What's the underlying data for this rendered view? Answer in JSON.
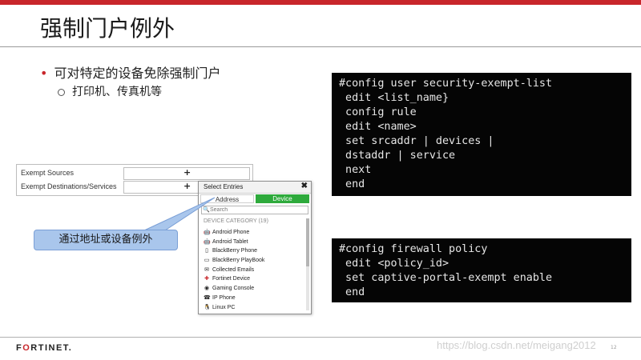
{
  "slide": {
    "title": "强制门户例外",
    "bullet_main": "可对特定的设备免除强制门户",
    "bullet_sub": "打印机、传真机等"
  },
  "exempt_form": {
    "rows": [
      {
        "label": "Exempt Sources",
        "add": "+"
      },
      {
        "label": "Exempt Destinations/Services",
        "add": "+"
      }
    ]
  },
  "select_popup": {
    "title": "Select Entries",
    "close": "✖",
    "tabs": [
      {
        "label": "Address",
        "active": false
      },
      {
        "label": "Device",
        "active": true
      }
    ],
    "search_placeholder": "Search",
    "category_label": "DEVICE CATEGORY (19)",
    "items": [
      {
        "label": "Android Phone",
        "icon": "android-icon",
        "color": "#7cb342"
      },
      {
        "label": "Android Tablet",
        "icon": "android-icon",
        "color": "#7cb342"
      },
      {
        "label": "BlackBerry Phone",
        "icon": "phone-icon",
        "color": "#222222"
      },
      {
        "label": "BlackBerry PlayBook",
        "icon": "tablet-icon",
        "color": "#222222"
      },
      {
        "label": "Collected Emails",
        "icon": "envelope-icon",
        "color": "#222222"
      },
      {
        "label": "Fortinet Device",
        "icon": "fortinet-icon",
        "color": "#c8262b"
      },
      {
        "label": "Gaming Console",
        "icon": "gamepad-icon",
        "color": "#222222"
      },
      {
        "label": "IP Phone",
        "icon": "handset-icon",
        "color": "#222222"
      },
      {
        "label": "Linux PC",
        "icon": "linux-icon",
        "color": "#222222"
      }
    ],
    "accent_color": "#2eaa3c"
  },
  "callout": {
    "text": "通过地址或设备例外"
  },
  "code_blocks": [
    {
      "lines": [
        "#config user security-exempt-list",
        " edit <list_name}",
        " config rule",
        " edit <name>",
        " set srcaddr | devices |",
        " dstaddr | service",
        " next",
        " end"
      ]
    },
    {
      "lines": [
        "#config firewall policy",
        " edit <policy_id>",
        " set captive-portal-exempt enable",
        " end"
      ]
    }
  ],
  "footer": {
    "logo_parts": [
      "F",
      "O",
      "RTINET."
    ],
    "watermark": "https://blog.csdn.net/meigang2012",
    "page_number": "12"
  },
  "colors": {
    "brand": "#c8262b",
    "callout_fill": "#a9c6ec",
    "code_bg": "#050505"
  }
}
